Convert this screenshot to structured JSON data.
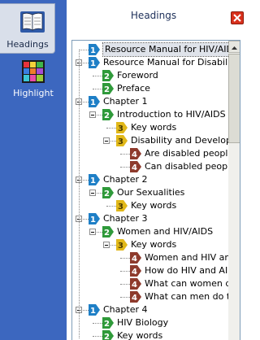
{
  "window": {
    "title": "Headings"
  },
  "rail": {
    "headings_label": "Headings",
    "highlight_label": "Highlight"
  },
  "level_colors": {
    "1": "#1e7fc6",
    "2": "#2f9a3a",
    "3": "#e1b81a",
    "4": "#8e3a2c"
  },
  "tree": [
    {
      "level": 1,
      "badge": "1",
      "text": "Resource Manual for HIV/AIDS",
      "toggle": false,
      "selected": true
    },
    {
      "level": 1,
      "badge": "1",
      "text": "Resource Manual for Disability a",
      "toggle": true
    },
    {
      "level": 2,
      "badge": "2",
      "text": "Foreword",
      "toggle": false
    },
    {
      "level": 2,
      "badge": "2",
      "text": "Preface",
      "toggle": false
    },
    {
      "level": 1,
      "badge": "1",
      "text": "Chapter 1",
      "toggle": true
    },
    {
      "level": 2,
      "badge": "2",
      "text": "Introduction to HIV/AIDS ar",
      "toggle": true
    },
    {
      "level": 3,
      "badge": "3",
      "text": "Key words",
      "toggle": false
    },
    {
      "level": 3,
      "badge": "3",
      "text": "Disability and Developm",
      "toggle": true
    },
    {
      "level": 4,
      "badge": "4",
      "text": "Are disabled people",
      "toggle": false
    },
    {
      "level": 4,
      "badge": "4",
      "text": "Can disabled people",
      "toggle": false
    },
    {
      "level": 1,
      "badge": "1",
      "text": "Chapter 2",
      "toggle": true
    },
    {
      "level": 2,
      "badge": "2",
      "text": "Our Sexualities",
      "toggle": true
    },
    {
      "level": 3,
      "badge": "3",
      "text": "Key words",
      "toggle": false
    },
    {
      "level": 1,
      "badge": "1",
      "text": "Chapter 3",
      "toggle": true
    },
    {
      "level": 2,
      "badge": "2",
      "text": "Women and HIV/AIDS",
      "toggle": true
    },
    {
      "level": 3,
      "badge": "3",
      "text": "Key words",
      "toggle": true
    },
    {
      "level": 4,
      "badge": "4",
      "text": "Women and HIV an",
      "toggle": false
    },
    {
      "level": 4,
      "badge": "4",
      "text": "How do HIV and AII",
      "toggle": false
    },
    {
      "level": 4,
      "badge": "4",
      "text": "What can women d",
      "toggle": false
    },
    {
      "level": 4,
      "badge": "4",
      "text": "What can men do t",
      "toggle": false
    },
    {
      "level": 1,
      "badge": "1",
      "text": "Chapter 4",
      "toggle": true
    },
    {
      "level": 2,
      "badge": "2",
      "text": "HIV Biology",
      "toggle": false
    },
    {
      "level": 2,
      "badge": "2",
      "text": "Key words",
      "toggle": false
    }
  ]
}
